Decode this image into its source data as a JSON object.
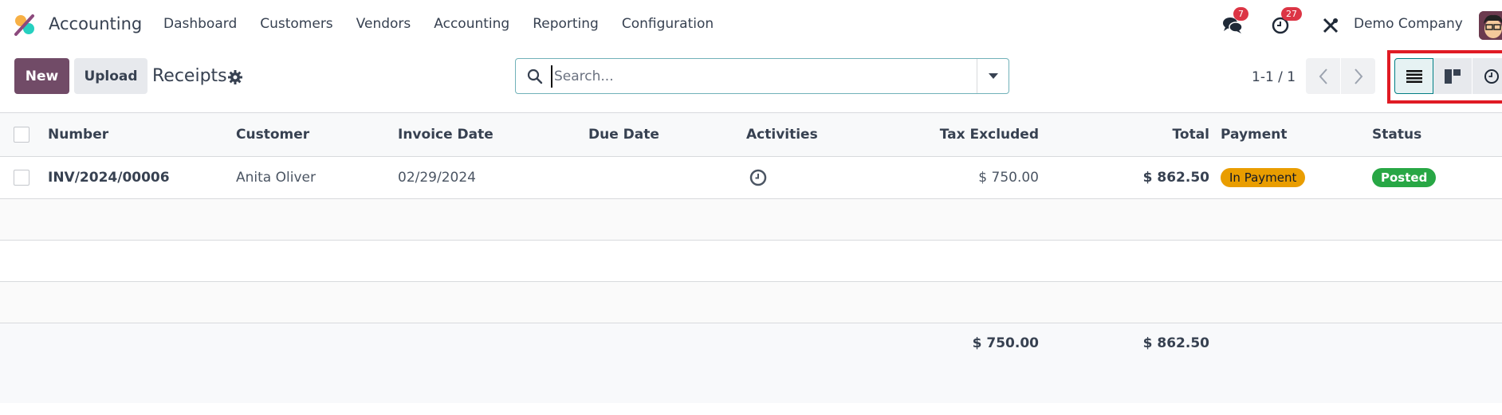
{
  "navbar": {
    "app_name": "Accounting",
    "menu": [
      {
        "label": "Dashboard"
      },
      {
        "label": "Customers"
      },
      {
        "label": "Vendors"
      },
      {
        "label": "Accounting"
      },
      {
        "label": "Reporting"
      },
      {
        "label": "Configuration"
      }
    ],
    "messages_badge": "7",
    "activities_badge": "27",
    "company": "Demo Company",
    "accent_color": "#714b67"
  },
  "control_panel": {
    "new_label": "New",
    "upload_label": "Upload",
    "title": "Receipts",
    "search": {
      "placeholder": "Search...",
      "value": ""
    },
    "pager": "1-1 / 1",
    "views": [
      {
        "name": "list",
        "active": true
      },
      {
        "name": "kanban",
        "active": false
      },
      {
        "name": "activity",
        "active": false
      }
    ]
  },
  "table": {
    "columns": [
      "Number",
      "Customer",
      "Invoice Date",
      "Due Date",
      "Activities",
      "Tax Excluded",
      "Total",
      "Payment",
      "Status"
    ],
    "rows": [
      {
        "number": "INV/2024/00006",
        "customer": "Anita Oliver",
        "invoice_date": "02/29/2024",
        "due_date": "",
        "activities_icon": "clock-icon",
        "tax_excluded": "$ 750.00",
        "total": "$ 862.50",
        "payment": "In Payment",
        "status": "Posted"
      }
    ],
    "totals": {
      "tax_excluded": "$ 750.00",
      "total": "$ 862.50"
    }
  }
}
